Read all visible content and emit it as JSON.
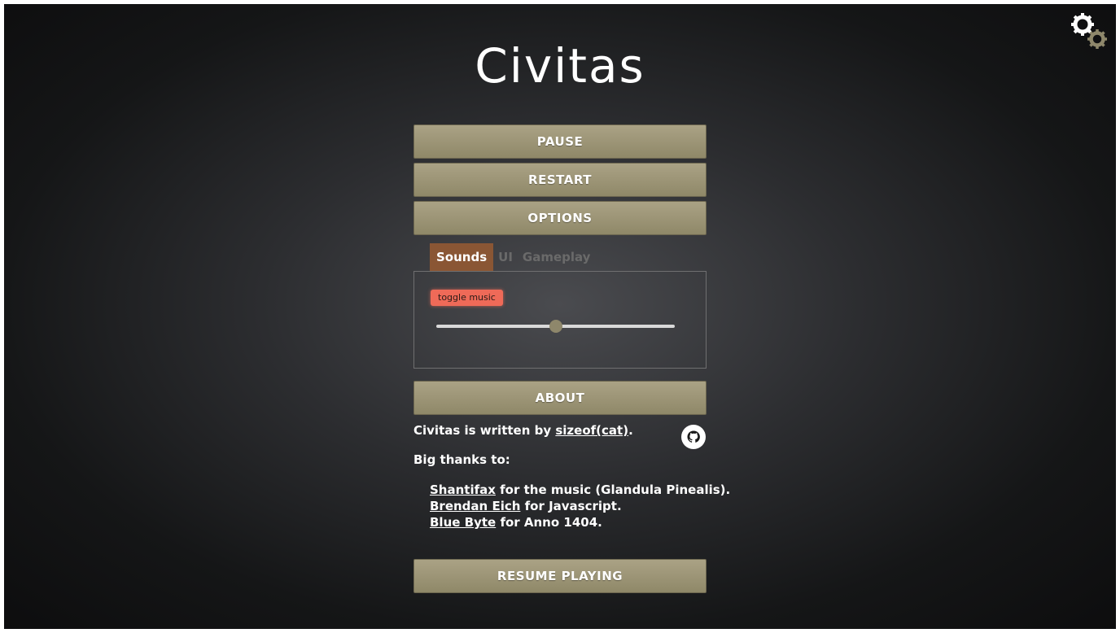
{
  "game": {
    "title": "Civitas"
  },
  "menu": {
    "pause_label": "PAUSE",
    "restart_label": "RESTART",
    "options_label": "OPTIONS",
    "about_label": "ABOUT",
    "resume_label": "RESUME PLAYING"
  },
  "options": {
    "tabs": [
      {
        "label": "Sounds",
        "active": true
      },
      {
        "label": "UI",
        "active": false
      },
      {
        "label": "Gameplay",
        "active": false
      }
    ],
    "toggle_music_label": "toggle music",
    "volume_fraction": 0.5
  },
  "about": {
    "written_prefix": "Civitas is written by ",
    "author": "sizeof(cat)",
    "written_suffix": ".",
    "thanks_heading": "Big thanks to:",
    "thanks": [
      {
        "name": "Shantifax",
        "text": " for the music (Glandula Pinealis)."
      },
      {
        "name": "Brendan Eich",
        "text": " for Javascript."
      },
      {
        "name": "Blue Byte",
        "text": " for Anno 1404."
      }
    ]
  },
  "colors": {
    "button": "#9d9676",
    "active_tab": "#8a5634",
    "toggle": "#ef6a58",
    "gear_white": "#ffffff",
    "gear_olive": "#8e876b"
  },
  "icons": {
    "settings": "settings-gears-icon",
    "github": "github-icon"
  }
}
